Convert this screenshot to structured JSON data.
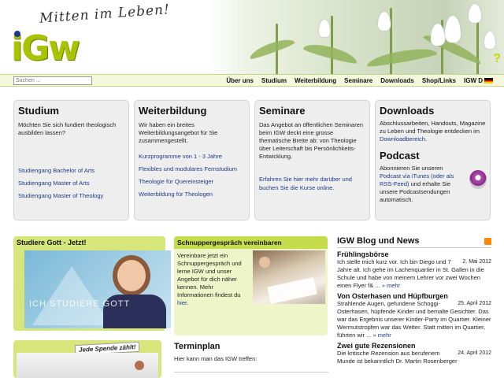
{
  "header": {
    "slogan": "Mitten im Leben!",
    "logo": "iGw"
  },
  "search": {
    "placeholder": "Suchen ..."
  },
  "nav": [
    "Über uns",
    "Studium",
    "Weiterbildung",
    "Seminare",
    "Downloads",
    "Shop/Links",
    "IGW D"
  ],
  "columns": {
    "studium": {
      "title": "Studium",
      "text": "Möchten Sie sich fundiert theologisch ausbilden lassen?",
      "links": [
        "Studiengang Bachelor of Arts",
        "Studiengang Master of Arts",
        "Studiengang Master of Theology"
      ]
    },
    "weiterbildung": {
      "title": "Weiterbildung",
      "text": "Wir haben ein breites Weiterbildungsangebot für Sie zusammengestellt.",
      "links": [
        "Kurzprogramme von 1 - 3 Jahre",
        "Flexibles und modulares Fernstudium",
        "Theologie für Quereinsteiger",
        "Weiterbildung für Theologen"
      ]
    },
    "seminare": {
      "title": "Seminare",
      "text": "Das Angebot an öffentlichen Seminaren beim IGW deckt eine grosse thematische Breite ab: von Theologie über Leiterschaft bis Persönlichkeits-Entwicklung.",
      "link": "Erfahren Sie hier mehr darüber und buchen Sie die Kurse online."
    },
    "downloads": {
      "title": "Downloads",
      "text_pre": "Abschlussarbeiten, Handouts, Magazine zu Leben und Theologie entdecken im ",
      "link": "Downloadbereich",
      "text_post": "."
    },
    "podcast": {
      "title": "Podcast",
      "text_pre": "Abonnieren Sie unseren ",
      "link": "Podcast via iTunes (oder als RSS-Feed)",
      "text_post": " und erhalte Sie unsere Podcastsendungen automatisch."
    }
  },
  "studiere": {
    "title": "Studiere Gott - Jetzt!",
    "overlay": "ICH STUDIERE GOTT"
  },
  "schnupper": {
    "title": "Schnuppergespräch vereinbaren",
    "text_pre": "Vereinbare jetzt ein Schnuppergespräch und lerne IGW und unser Angebot für dich näher kennen. Mehr Informationen findest du ",
    "link": "hier",
    "text_post": "."
  },
  "spende": {
    "label": "Jede Spende zählt!"
  },
  "terminplan": {
    "title": "Terminplan",
    "text": "Hier kann man das IGW treffen:"
  },
  "blog": {
    "title": "IGW Blog und News",
    "posts": [
      {
        "title": "Frühlingsbörse",
        "date": "2. Mai 2012",
        "text": "Ich stelle mich kurz vor. Ich bin Diego und 7 Jahre alt. Ich gehe im Lachenquartier in St. Gallen in die Schule und habe von meinem Lehrer vor zwei Wochen einen Flyer f& ...",
        "more": "» mehr"
      },
      {
        "title": "Von Osterhasen und Hüpfburgen",
        "date": "25. April 2012",
        "text": "Strahlende Augen, gefundene Schoggi-Osterhasen, hüpfende Kinder und bemalte Gesichter. Das war das Ergebnis unserer Kinder-Party im Quartier. Kleiner Wermutstropfen war das Wetter. Statt mitten im Quartier, führten wir ...",
        "more": "» mehr"
      },
      {
        "title": "Zwei gute Rezensionen",
        "date": "24. April 2012",
        "text": "Die kritische Rezension aus berufenem Munde ist bekanntlich Dr. Martin Rosenberger",
        "more": ""
      }
    ]
  }
}
